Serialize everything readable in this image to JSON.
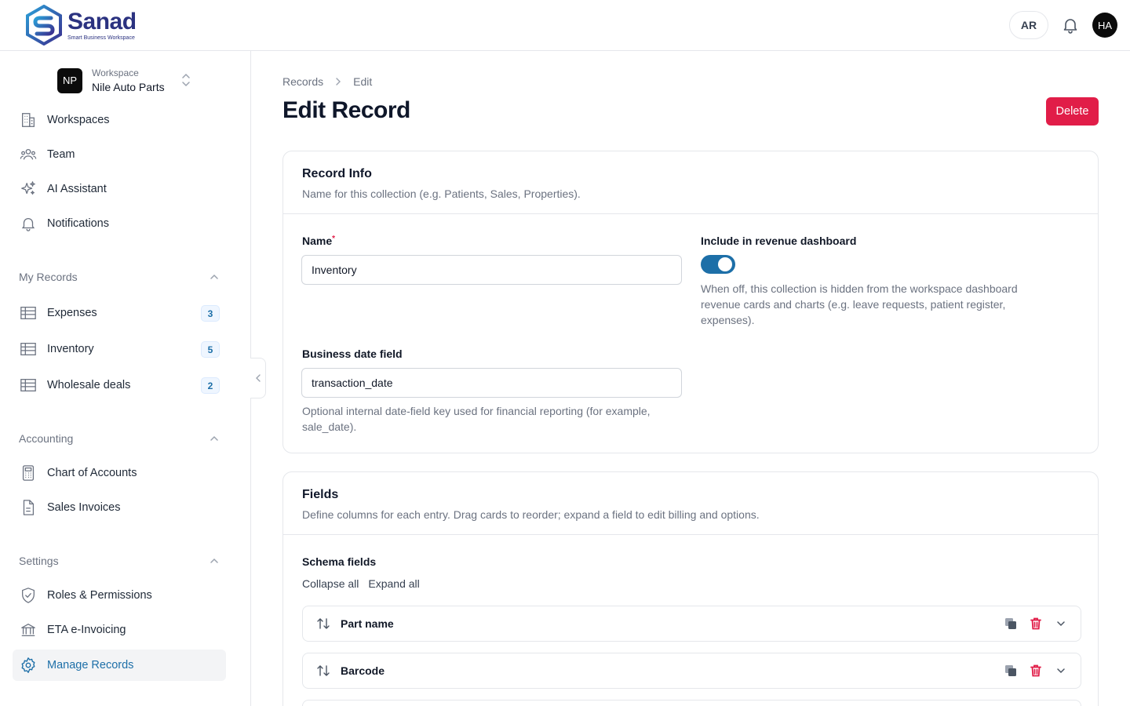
{
  "brand": {
    "name": "Sanad",
    "tagline": "Smart Business Workspace"
  },
  "topbar": {
    "lang": "AR",
    "user_initials": "HA"
  },
  "workspace": {
    "label": "Workspace",
    "name": "Nile Auto Parts",
    "initials": "NP"
  },
  "nav_main": [
    {
      "label": "Workspaces",
      "icon": "building-icon"
    },
    {
      "label": "Team",
      "icon": "users-icon"
    },
    {
      "label": "AI Assistant",
      "icon": "sparkles-icon"
    },
    {
      "label": "Notifications",
      "icon": "bell-icon"
    }
  ],
  "sections": {
    "my_records": {
      "title": "My Records",
      "items": [
        {
          "label": "Expenses",
          "count": "3"
        },
        {
          "label": "Inventory",
          "count": "5"
        },
        {
          "label": "Wholesale deals",
          "count": "2"
        }
      ]
    },
    "accounting": {
      "title": "Accounting",
      "items": [
        {
          "label": "Chart of Accounts"
        },
        {
          "label": "Sales Invoices"
        }
      ]
    },
    "settings": {
      "title": "Settings",
      "items": [
        {
          "label": "Roles & Permissions"
        },
        {
          "label": "ETA e-Invoicing"
        },
        {
          "label": "Manage Records"
        }
      ]
    }
  },
  "breadcrumb": [
    "Records",
    "Edit"
  ],
  "page": {
    "title": "Edit Record",
    "delete_label": "Delete"
  },
  "record_info": {
    "title": "Record Info",
    "subtitle": "Name for this collection (e.g. Patients, Sales, Properties).",
    "name_label": "Name",
    "required_mark": "*",
    "name_value": "Inventory",
    "revenue_label": "Include in revenue dashboard",
    "revenue_on": true,
    "revenue_help": "When off, this collection is hidden from the workspace dashboard revenue cards and charts (e.g. leave requests, patient register, expenses).",
    "date_label": "Business date field",
    "date_value": "transaction_date",
    "date_help": "Optional internal date-field key used for financial reporting (for example, sale_date)."
  },
  "fields": {
    "title": "Fields",
    "subtitle": "Define columns for each entry. Drag cards to reorder; expand a field to edit billing and options.",
    "schema_label": "Schema fields",
    "collapse_all": "Collapse all",
    "expand_all": "Expand all",
    "rows": [
      {
        "name": "Part name"
      },
      {
        "name": "Barcode"
      }
    ]
  },
  "colors": {
    "accent": "#1d6fa8",
    "danger": "#e11d48",
    "brand": "#2b3280"
  }
}
